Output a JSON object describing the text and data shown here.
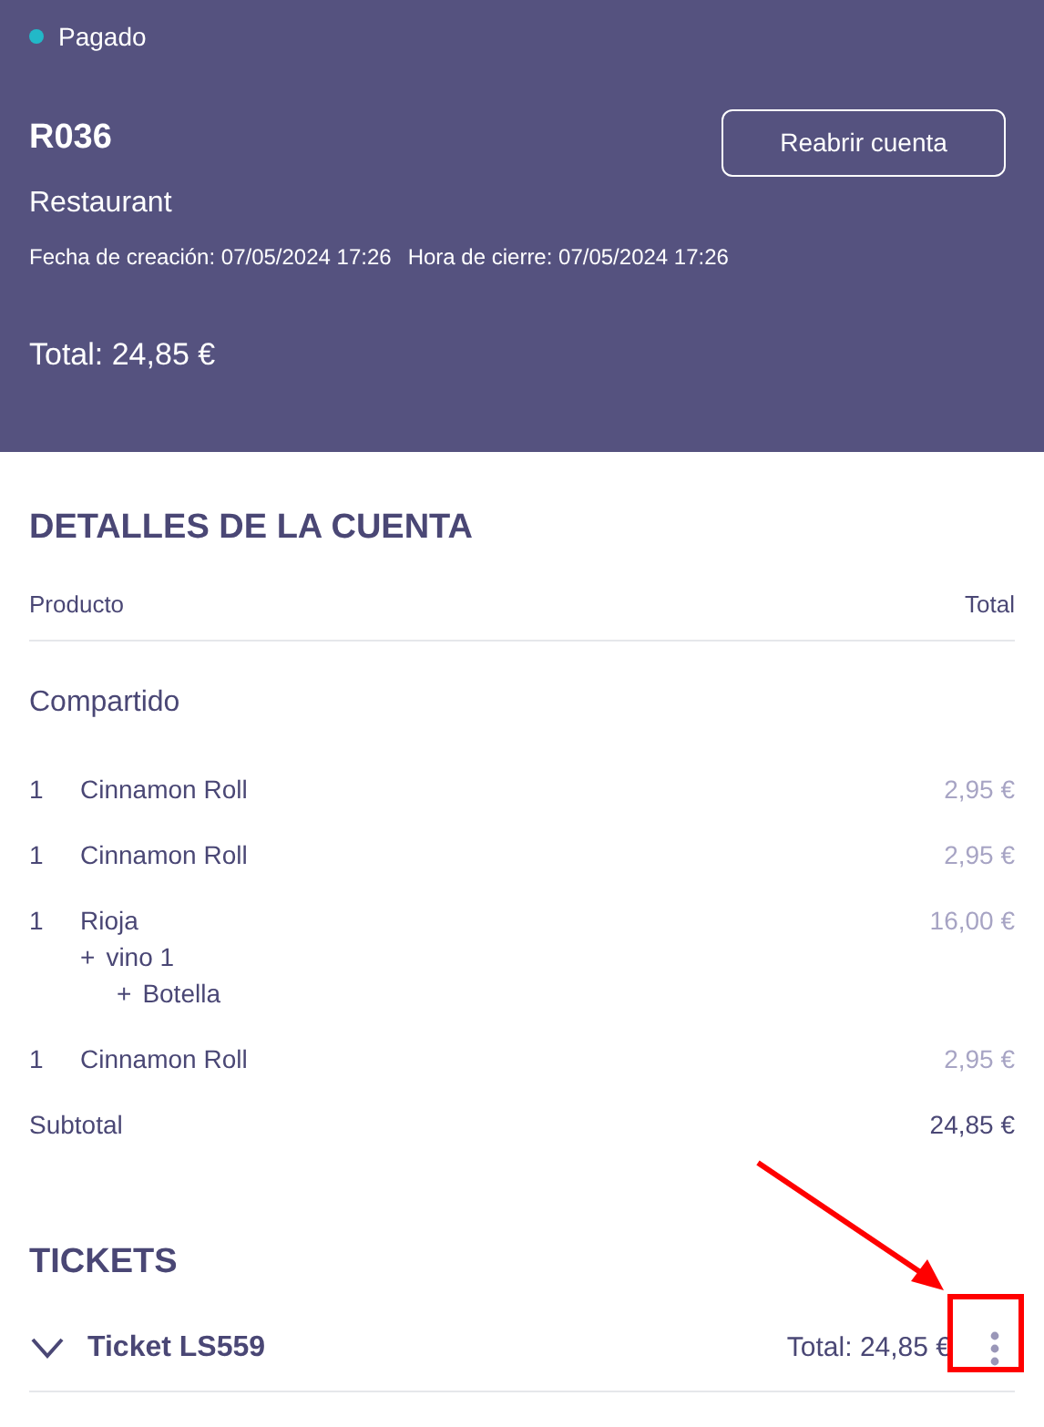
{
  "header": {
    "status": {
      "label": "Pagado",
      "color": "#22b8c8"
    },
    "code": "R036",
    "reopen_button": "Reabrir cuenta",
    "location": "Restaurant",
    "created": "Fecha de creación: 07/05/2024 17:26",
    "closed": "Hora de cierre: 07/05/2024 17:26",
    "total": "Total: 24,85 €"
  },
  "details": {
    "title": "DETALLES DE LA CUENTA",
    "columns": [
      "Producto",
      "Total"
    ],
    "group": "Compartido",
    "items": [
      {
        "qty": "1",
        "name": "Cinnamon Roll",
        "price": "2,95 €"
      },
      {
        "qty": "1",
        "name": "Cinnamon Roll",
        "price": "2,95 €"
      },
      {
        "qty": "1",
        "name": "Rioja",
        "price": "16,00 €",
        "children": [
          {
            "prefix": "+",
            "name": "vino 1",
            "children": [
              {
                "prefix": "+",
                "name": "Botella"
              }
            ]
          }
        ]
      },
      {
        "qty": "1",
        "name": "Cinnamon Roll",
        "price": "2,95 €"
      }
    ],
    "subtotal_label": "Subtotal",
    "subtotal": "24,85 €"
  },
  "tickets": {
    "title": "TICKETS",
    "items": [
      {
        "name": "Ticket LS559",
        "total": "Total: 24,85 €",
        "expanded": false
      }
    ]
  }
}
